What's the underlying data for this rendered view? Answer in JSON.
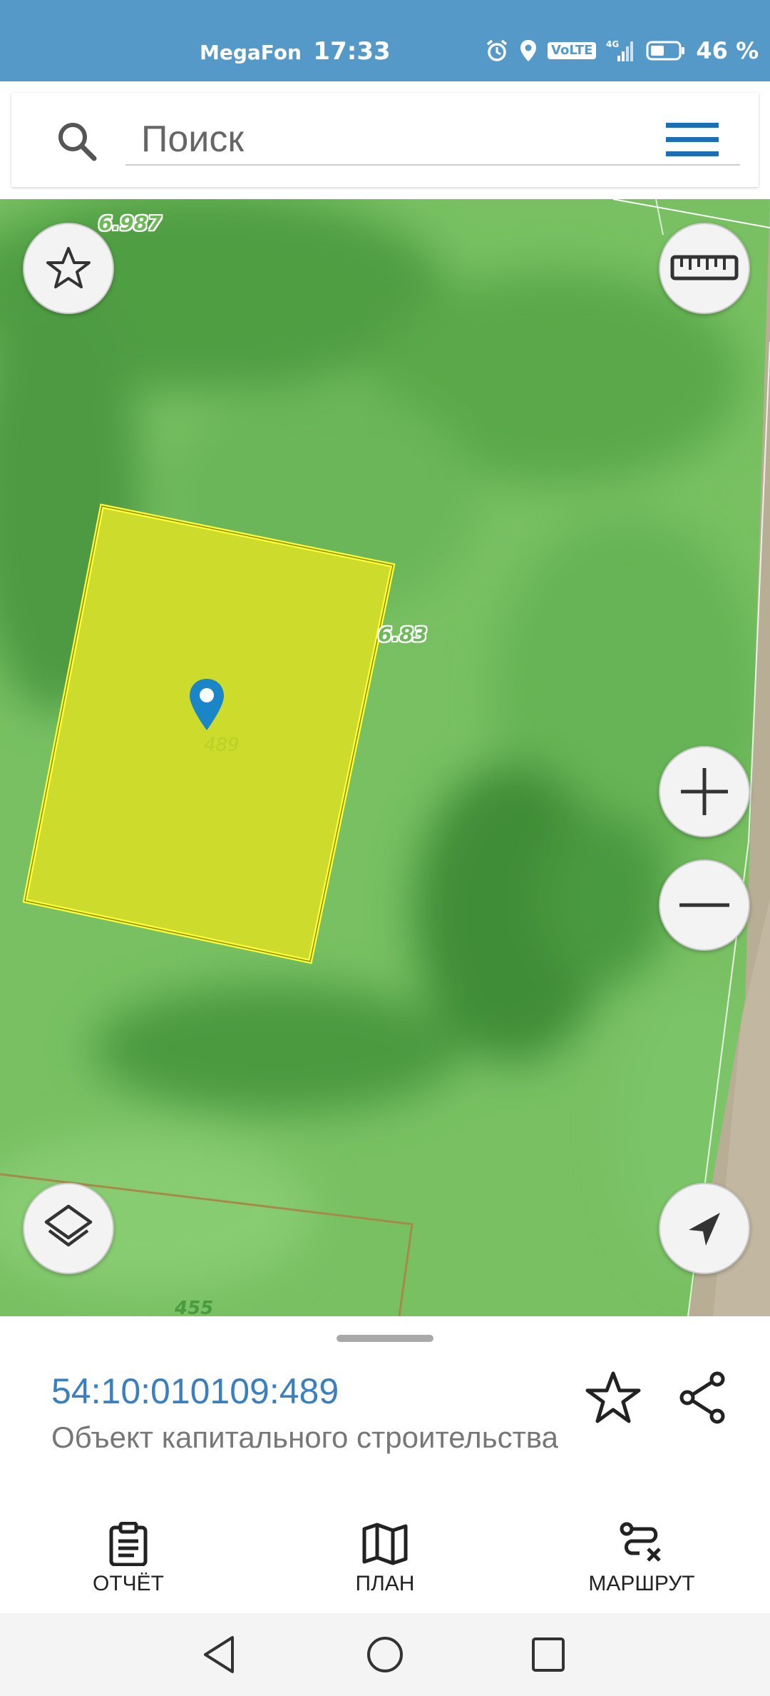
{
  "status_bar": {
    "carrier": "MegaFon",
    "time": "17:33",
    "network": "VoLTE",
    "battery": "46 %"
  },
  "search": {
    "placeholder": "Поиск"
  },
  "map": {
    "labels": {
      "top_left": "6.987",
      "right_of_parcel": "6.83",
      "selected_parcel": "489",
      "bottom_parcel": "455"
    },
    "colors": {
      "selected_fill": "#cddc2c",
      "selected_border": "#ffff33",
      "marker": "#1a86c8"
    }
  },
  "details": {
    "cadastral_number": "54:10:010109:489",
    "object_type": "Объект капитального строительства"
  },
  "bottom_nav": {
    "report": "ОТЧЁТ",
    "plan": "ПЛАН",
    "route": "МАРШРУТ"
  },
  "icons": {
    "status": [
      "alarm-icon",
      "location-icon",
      "signal-icon",
      "battery-icon"
    ],
    "map_buttons": [
      "favorite-star-icon",
      "ruler-icon",
      "zoom-in-icon",
      "zoom-out-icon",
      "layers-icon",
      "my-location-icon"
    ],
    "sheet": [
      "star-icon",
      "share-icon"
    ],
    "nav": [
      "report-icon",
      "map-icon",
      "route-icon"
    ],
    "system": [
      "back-icon",
      "home-icon",
      "recents-icon"
    ]
  }
}
